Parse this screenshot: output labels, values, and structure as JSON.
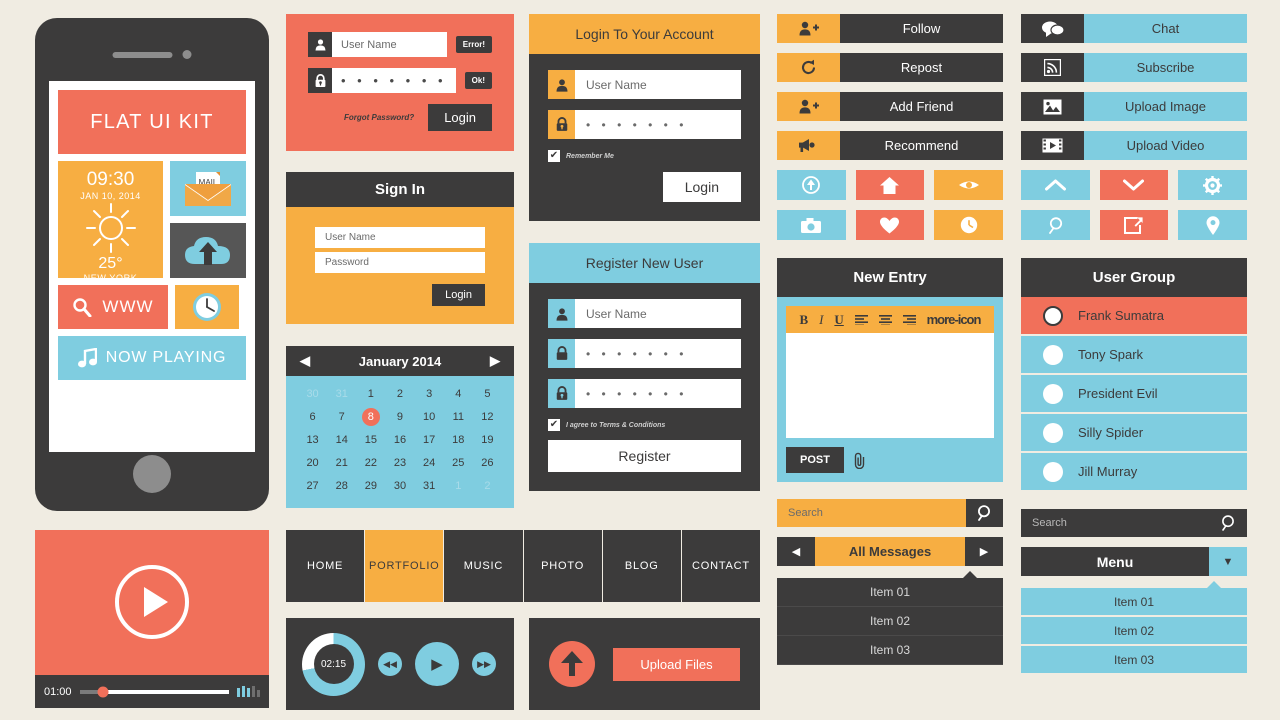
{
  "palette": {
    "bg": "#f0ece2",
    "orange": "#f1705a",
    "yellow": "#f7ae42",
    "blue": "#7fcde0",
    "dark": "#3c3b3b"
  },
  "phone": {
    "title": "FLAT UI KIT",
    "weather": {
      "time": "09:30",
      "date": "JAN 10, 2014",
      "temp": "25°",
      "city": "NEW YORK"
    },
    "mail_label": "MAIL",
    "www_label": "WWW",
    "now_playing_label": "NOW PLAYING"
  },
  "login_orange": {
    "username_value": "User Name",
    "password_value": "• • • • • • •",
    "username_status": "Error!",
    "password_status": "Ok!",
    "forgot_label": "Forgot Password?",
    "login_label": "Login"
  },
  "signin": {
    "title": "Sign In",
    "username_placeholder": "User Name",
    "password_placeholder": "Password",
    "login_label": "Login"
  },
  "calendar": {
    "month_label": "January 2014",
    "prev_label": "◀",
    "next_label": "▶",
    "selected_day": 8,
    "weeks": [
      [
        {
          "d": "30",
          "m": true
        },
        {
          "d": "31",
          "m": true
        },
        {
          "d": "1"
        },
        {
          "d": "2"
        },
        {
          "d": "3"
        },
        {
          "d": "4"
        },
        {
          "d": "5"
        }
      ],
      [
        {
          "d": "6"
        },
        {
          "d": "7"
        },
        {
          "d": "8",
          "s": true
        },
        {
          "d": "9"
        },
        {
          "d": "10"
        },
        {
          "d": "11"
        },
        {
          "d": "12"
        }
      ],
      [
        {
          "d": "13"
        },
        {
          "d": "14"
        },
        {
          "d": "15"
        },
        {
          "d": "16"
        },
        {
          "d": "17"
        },
        {
          "d": "18"
        },
        {
          "d": "19"
        }
      ],
      [
        {
          "d": "20"
        },
        {
          "d": "21"
        },
        {
          "d": "22"
        },
        {
          "d": "23"
        },
        {
          "d": "24"
        },
        {
          "d": "25"
        },
        {
          "d": "26"
        }
      ],
      [
        {
          "d": "27"
        },
        {
          "d": "28"
        },
        {
          "d": "29"
        },
        {
          "d": "30"
        },
        {
          "d": "31"
        },
        {
          "d": "1",
          "m": true
        },
        {
          "d": "2",
          "m": true
        }
      ]
    ]
  },
  "login_account": {
    "title": "Login To Your Account",
    "username_value": "User Name",
    "password_value": "• • • • • • •",
    "remember_label": "Remember Me",
    "login_label": "Login"
  },
  "register": {
    "title": "Register New User",
    "username_value": "User Name",
    "password_value": "• • • • • • •",
    "confirm_value": "• • • • • • •",
    "terms_label": "I agree to Terms & Conditions",
    "register_label": "Register"
  },
  "social_left": {
    "buttons": [
      {
        "label": "Follow",
        "icon": "add-user-icon"
      },
      {
        "label": "Repost",
        "icon": "repost-icon"
      },
      {
        "label": "Add Friend",
        "icon": "add-user-icon"
      },
      {
        "label": "Recommend",
        "icon": "megaphone-icon"
      }
    ],
    "squares": [
      {
        "icon": "arrow-up-circle-icon",
        "color": "#7fcde0"
      },
      {
        "icon": "home-icon",
        "color": "#f1705a"
      },
      {
        "icon": "eye-icon",
        "color": "#f7ae42"
      },
      {
        "icon": "camera-icon",
        "color": "#7fcde0"
      },
      {
        "icon": "heart-icon",
        "color": "#f1705a"
      },
      {
        "icon": "clock-icon",
        "color": "#f7ae42"
      }
    ]
  },
  "social_right": {
    "buttons": [
      {
        "label": "Chat",
        "icon": "chat-bubbles-icon"
      },
      {
        "label": "Subscribe",
        "icon": "rss-icon"
      },
      {
        "label": "Upload Image",
        "icon": "image-icon"
      },
      {
        "label": "Upload Video",
        "icon": "video-icon"
      }
    ],
    "squares": [
      {
        "icon": "chevron-up-icon",
        "color": "#7fcde0"
      },
      {
        "icon": "chevron-down-icon",
        "color": "#f1705a"
      },
      {
        "icon": "gear-icon",
        "color": "#7fcde0"
      },
      {
        "icon": "search-icon",
        "color": "#7fcde0"
      },
      {
        "icon": "share-icon",
        "color": "#f1705a"
      },
      {
        "icon": "location-pin-icon",
        "color": "#7fcde0"
      }
    ]
  },
  "new_entry": {
    "title": "New Entry",
    "toolbar": [
      "B",
      "I",
      "U",
      "align-left-icon",
      "align-center-icon",
      "align-right-icon",
      "more-icon"
    ],
    "body_value": "",
    "post_label": "POST",
    "attach_icon": "paperclip-icon"
  },
  "user_group": {
    "title": "User Group",
    "members": [
      {
        "name": "Frank Sumatra",
        "active": true
      },
      {
        "name": "Tony Spark",
        "active": false
      },
      {
        "name": "President Evil",
        "active": false
      },
      {
        "name": "Silly Spider",
        "active": false
      },
      {
        "name": "Jill Murray",
        "active": false
      }
    ]
  },
  "search_orange": {
    "placeholder": "Search",
    "icon": "search-icon"
  },
  "messages_bar": {
    "label": "All Messages",
    "prev": "◀",
    "next": "▶"
  },
  "dropdown_dark": {
    "items": [
      "Item 01",
      "Item 02",
      "Item 03"
    ]
  },
  "search_dark": {
    "placeholder": "Search",
    "icon": "search-icon"
  },
  "menu_bar": {
    "label": "Menu",
    "caret": "▼"
  },
  "dropdown_blue": {
    "items": [
      "Item 01",
      "Item 02",
      "Item 03"
    ]
  },
  "video_player": {
    "time": "01:00",
    "progress_percent": 16,
    "play_icon": "play-icon"
  },
  "nav": {
    "items": [
      {
        "label": "HOME",
        "active": false
      },
      {
        "label": "PORTFOLIO",
        "active": true
      },
      {
        "label": "MUSIC",
        "active": false
      },
      {
        "label": "PHOTO",
        "active": false
      },
      {
        "label": "BLOG",
        "active": false
      },
      {
        "label": "CONTACT",
        "active": false
      }
    ]
  },
  "music_player": {
    "time": "02:15",
    "progress_percent": 72,
    "prev": "◀◀",
    "play": "▶",
    "next": "▶▶"
  },
  "upload": {
    "label": "Upload Files",
    "icon": "arrow-up-icon"
  }
}
